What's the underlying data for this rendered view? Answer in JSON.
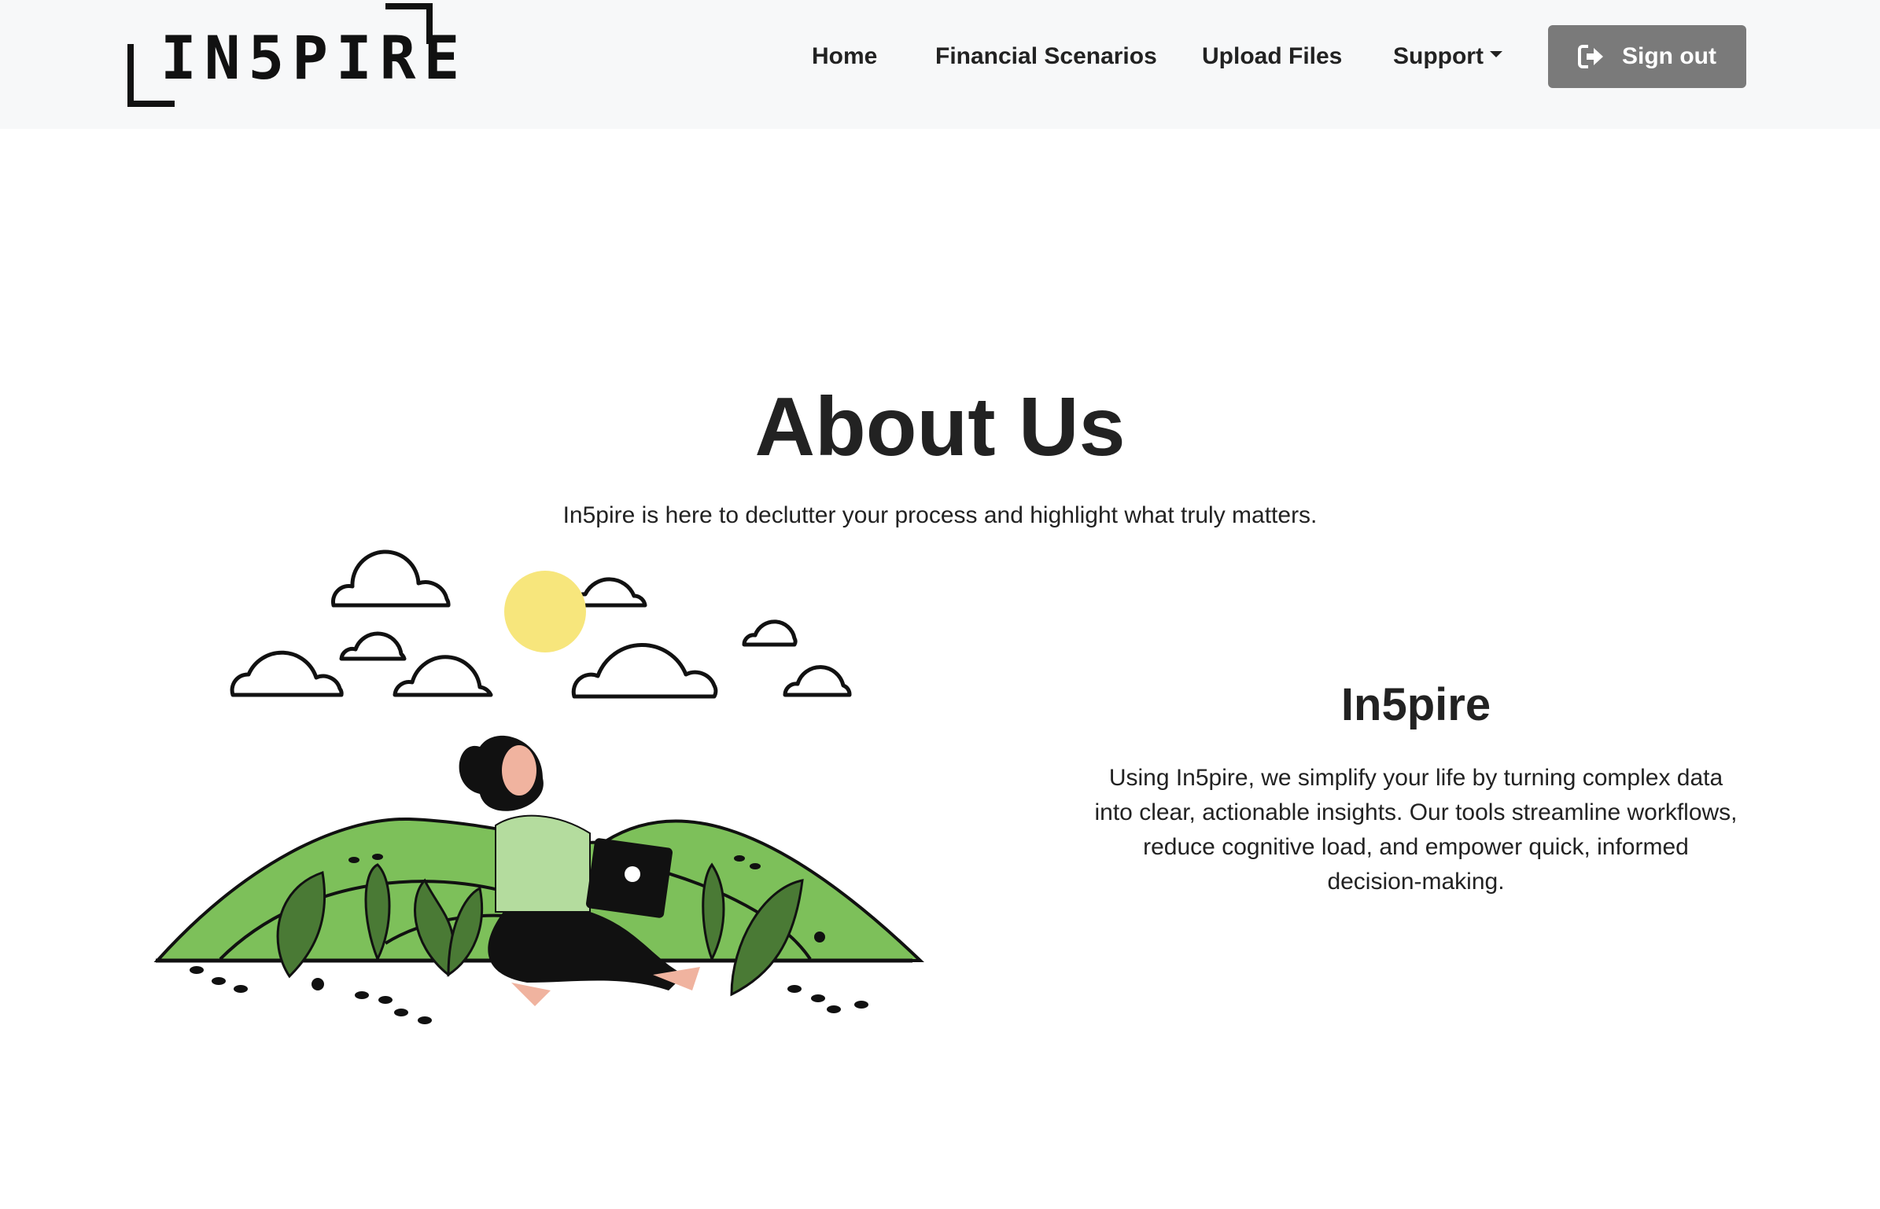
{
  "navbar": {
    "logo_text": "IN5PIRE",
    "links": [
      {
        "label": "Home"
      },
      {
        "label": "Financial Scenarios"
      },
      {
        "label": "Upload Files"
      },
      {
        "label": "Support"
      }
    ],
    "signout_label": "Sign out",
    "signout_icon": "sign-out-icon",
    "signout_color": "#7a7a7a"
  },
  "main": {
    "title": "About Us",
    "subtitle": "In5pire is here to declutter your process and highlight what truly matters.",
    "brand_heading": "In5pire",
    "brand_description": "Using In5pire, we simplify your life by turning complex data into clear, actionable insights. Our tools streamline workflows, reduce cognitive load, and empower quick, informed decision-making."
  },
  "colors": {
    "hill_green": "#7dc05a",
    "leaf_dark": "#4a7a35",
    "sun_yellow": "#f7e67c",
    "shirt_green": "#b4dc9e",
    "skin": "#f0b39f"
  }
}
